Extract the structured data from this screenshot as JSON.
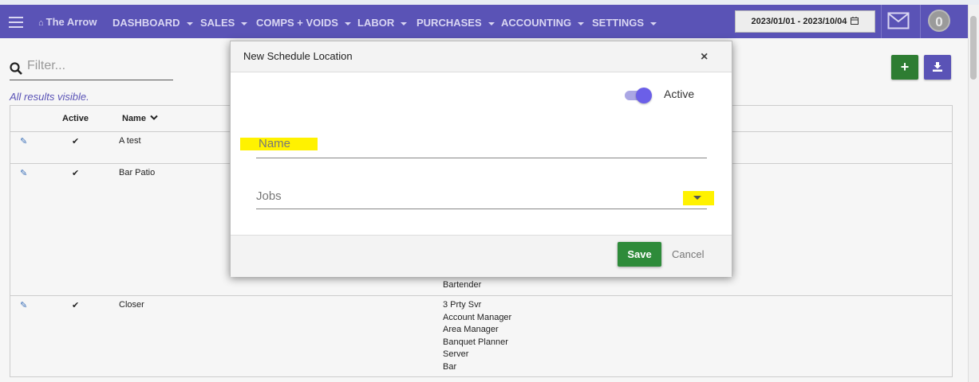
{
  "navbar": {
    "brand": "The Arrow",
    "menus": [
      "DASHBOARD",
      "SALES",
      "COMPS + VOIDS",
      "LABOR",
      "PURCHASES",
      "ACCOUNTING",
      "SETTINGS"
    ],
    "date_range": "2023/01/01 - 2023/10/04",
    "notification_count": "0",
    "bg_color": "#5a53b6"
  },
  "filter": {
    "placeholder": "Filter...",
    "value": ""
  },
  "results_text": "All results visible.",
  "table": {
    "headers": {
      "active": "Active",
      "name": "Name"
    },
    "rows": [
      {
        "active": "✔",
        "name": "A test",
        "jobs": []
      },
      {
        "active": "✔",
        "name": "Bar Patio",
        "jobs": [
          "Bartender"
        ]
      },
      {
        "active": "✔",
        "name": "Closer",
        "jobs": [
          "3 Prty Svr",
          "Account Manager",
          "Area Manager",
          "Banquet Planner",
          "Server",
          "Bar"
        ]
      }
    ]
  },
  "modal": {
    "title": "New Schedule Location",
    "close": "×",
    "active_label": "Active",
    "active_on": true,
    "name_placeholder": "Name",
    "jobs_label": "Jobs",
    "save_label": "Save",
    "cancel_label": "Cancel"
  },
  "icons": [
    "menu-icon",
    "home-icon",
    "calendar-icon",
    "mail-icon",
    "search-icon",
    "plus-icon",
    "download-icon",
    "edit-icon",
    "close-icon"
  ],
  "colors": {
    "save": "#2e8b3a",
    "add": "#2e7d32",
    "toggle": "#6b5fe8",
    "highlight": "#fff200"
  }
}
